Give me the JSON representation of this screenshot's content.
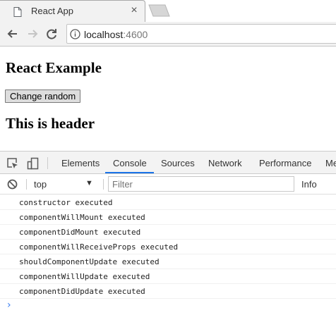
{
  "browser": {
    "tab_title": "React App",
    "tab_close_glyph": "×",
    "url_host": "localhost",
    "url_port": ":4600"
  },
  "page": {
    "heading": "React Example",
    "button_label": "Change random",
    "subheading": "This is header"
  },
  "devtools": {
    "tabs": [
      "Elements",
      "Console",
      "Sources",
      "Network",
      "Performance",
      "Me"
    ],
    "active_tab": "Console",
    "context": "top",
    "context_arrow": "▼",
    "filter_placeholder": "Filter",
    "level": "Info",
    "prompt_glyph": "›",
    "accent_color": "#1a73e8"
  },
  "console_logs": [
    "constructor executed",
    "componentWillMount executed",
    "componentDidMount executed",
    "componentWillReceiveProps executed",
    "shouldComponentUpdate executed",
    "componentWillUpdate executed",
    "componentDidUpdate executed"
  ]
}
